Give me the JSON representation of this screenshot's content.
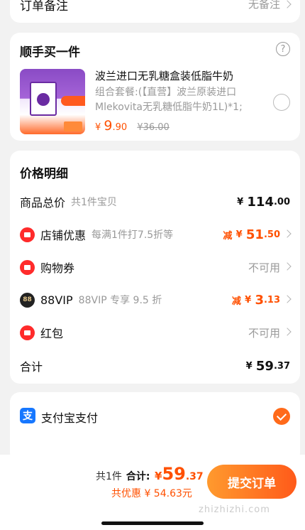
{
  "note": {
    "label": "订单备注",
    "value": "无备注"
  },
  "addon": {
    "title": "顺手买一件",
    "help_icon": "?",
    "product": {
      "title": "波兰进口无乳糖盒装低脂牛奶",
      "desc": "组合套餐:(【直营】波兰原装进口Mlekovita无乳糖低脂牛奶1L)*1;",
      "price_yen": "¥",
      "price_int": "9",
      "price_dec": ".90",
      "orig_price": "¥36.00"
    }
  },
  "detail": {
    "title": "价格明细",
    "goods": {
      "label": "商品总价",
      "sub": "共1件宝贝",
      "yen": "¥",
      "int": "114",
      "dec": ".00"
    },
    "shop": {
      "label": "店铺优惠",
      "sub": "每满1件打7.5折等",
      "prefix": "减",
      "yen": "¥",
      "int": "51",
      "dec": ".50"
    },
    "coupon": {
      "label": "购物券",
      "value": "不可用"
    },
    "vip": {
      "badge": "88",
      "label": "88VIP",
      "sub": "88VIP 专享 9.5 折",
      "prefix": "减",
      "yen": "¥",
      "int": "3",
      "dec": ".13"
    },
    "redpacket": {
      "label": "红包",
      "value": "不可用"
    },
    "sum": {
      "label": "合计",
      "yen": "¥",
      "int": "59",
      "dec": ".37"
    }
  },
  "pay": {
    "icon": "支",
    "label": "支付宝支付"
  },
  "bar": {
    "count": "共1件",
    "total_label": "合计:",
    "yen": "¥",
    "int": "59",
    "dec": ".37",
    "saving": "共优惠 ¥ 54.63元",
    "submit": "提交订单",
    "watermark": "zhizhizhi.com"
  },
  "colors": {
    "accent": "#ff5000",
    "alipay": "#1677ff"
  }
}
